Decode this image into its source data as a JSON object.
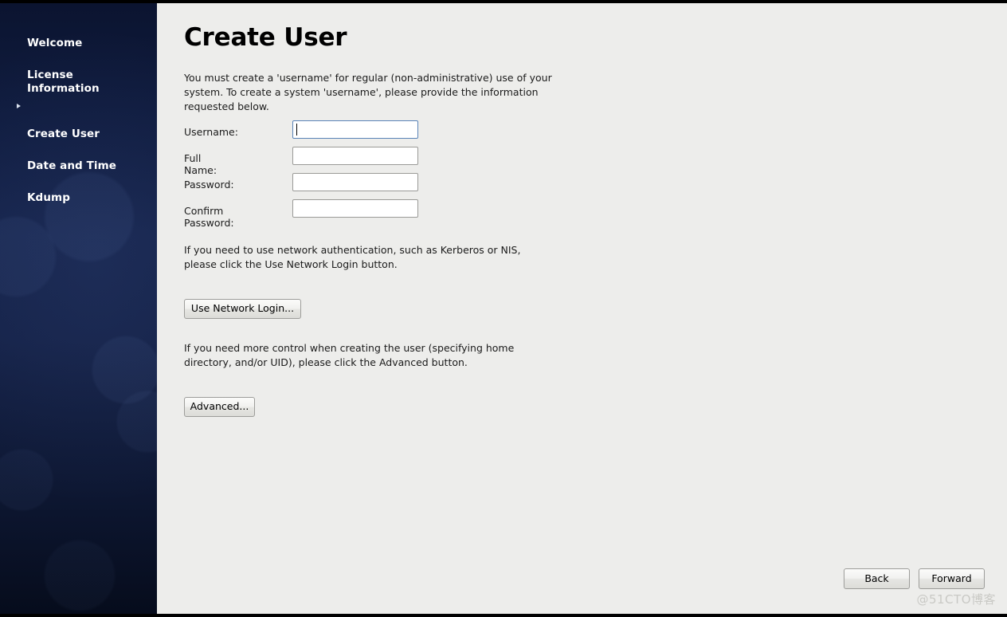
{
  "window": {
    "title": "Create User",
    "background_color": "#ededeb",
    "sidebar_color": "#16244c"
  },
  "sidebar": {
    "items": [
      {
        "label": "Welcome",
        "selected": false
      },
      {
        "label": "License\nInformation",
        "selected": false
      },
      {
        "label": "Create User",
        "selected": true
      },
      {
        "label": "Date and Time",
        "selected": false
      },
      {
        "label": "Kdump",
        "selected": false
      }
    ],
    "marker_icon": "caret-right-icon"
  },
  "main": {
    "title": "Create User",
    "intro_text": "You must create a 'username' for regular (non-administrative) use of your\nsystem.  To create a system 'username', please provide the information\nrequested below.",
    "network_text": "If you need to use network authentication, such as Kerberos or NIS,\nplease click the Use Network Login button.",
    "advanced_text": "If you need more control when creating the user (specifying home\ndirectory, and/or UID), please click the Advanced button.",
    "form": {
      "fields": [
        {
          "label": "Username:",
          "value": "",
          "placeholder": "",
          "type": "text",
          "focused": true
        },
        {
          "label": "Full Name:",
          "value": "",
          "placeholder": "",
          "type": "text",
          "focused": false
        },
        {
          "label": "Password:",
          "value": "",
          "placeholder": "",
          "type": "password",
          "focused": false
        },
        {
          "label": "Confirm Password:",
          "value": "",
          "placeholder": "",
          "type": "password",
          "focused": false
        }
      ]
    },
    "buttons": {
      "network_login": "Use Network Login...",
      "advanced": "Advanced..."
    }
  },
  "footer": {
    "back": "Back",
    "forward": "Forward"
  },
  "watermark": {
    "text": "@51CTO博客"
  }
}
